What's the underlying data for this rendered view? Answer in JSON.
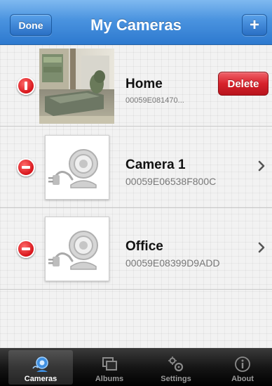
{
  "navbar": {
    "done_label": "Done",
    "title": "My Cameras",
    "add_label": "+"
  },
  "cameras": [
    {
      "name": "Home",
      "id": "00059E081470...",
      "delete_label": "Delete",
      "thumbnail": "living-room-photo"
    },
    {
      "name": "Camera 1",
      "id": "00059E06538F800C",
      "thumbnail": "camera-placeholder-icon"
    },
    {
      "name": "Office",
      "id": "00059E08399D9ADD",
      "thumbnail": "camera-placeholder-icon"
    }
  ],
  "tabbar": {
    "tabs": [
      {
        "label": "Cameras",
        "icon": "camera-icon",
        "active": true
      },
      {
        "label": "Albums",
        "icon": "albums-icon",
        "active": false
      },
      {
        "label": "Settings",
        "icon": "gears-icon",
        "active": false
      },
      {
        "label": "About",
        "icon": "info-icon",
        "active": false
      }
    ]
  },
  "colors": {
    "navbar_blue": "#4a93df",
    "delete_red": "#d7222b",
    "tabbar_black": "#161616"
  }
}
